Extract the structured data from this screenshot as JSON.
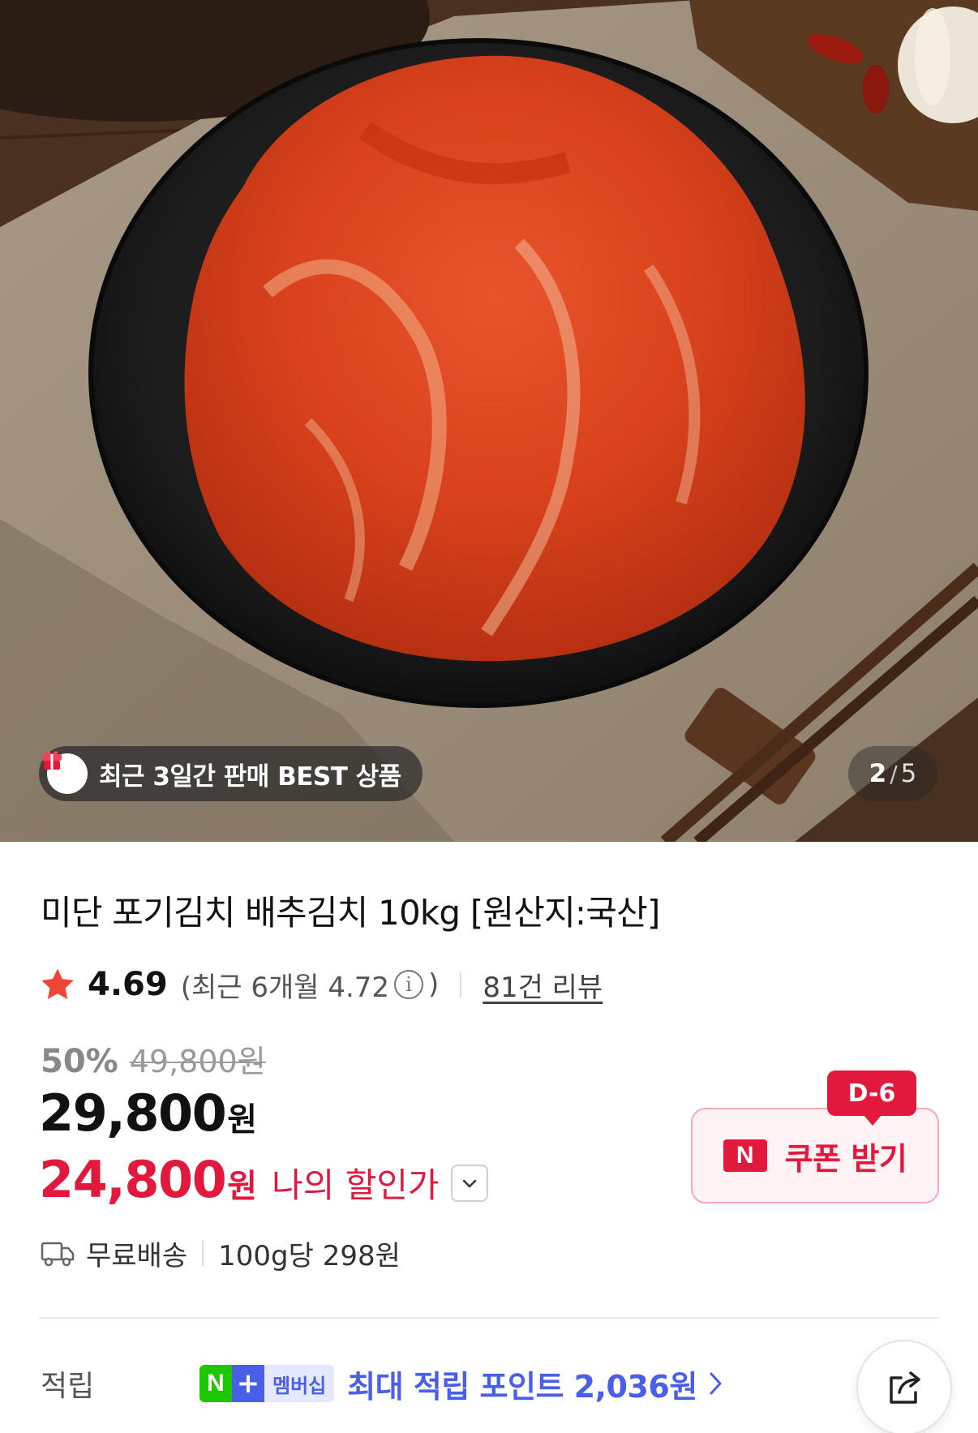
{
  "gallery": {
    "badge_label": "최근 3일간 판매 BEST 상품",
    "current_page": "2",
    "page_separator": "/",
    "total_pages": "5"
  },
  "product": {
    "title": "미단 포기김치 배추김치 10kg [원산지:국산]"
  },
  "rating": {
    "score": "4.69",
    "recent_label": "(최근 6개월 4.72",
    "recent_close": ")",
    "info_glyph": "i",
    "review_link": "81건 리뷰"
  },
  "price": {
    "discount_rate": "50%",
    "original_price": "49,800원",
    "sale_price": "29,800",
    "sale_unit": "원",
    "my_price": "24,800",
    "my_unit": "원",
    "my_price_label": "나의 할인가"
  },
  "coupon": {
    "dday": "D-6",
    "logo": "N",
    "label": "쿠폰 받기"
  },
  "shipping": {
    "label": "무료배송",
    "unit_price": "100g당 298원"
  },
  "points": {
    "label": "적립",
    "n_logo": "N",
    "plus_glyph": "+",
    "membership_label": "멤버십",
    "text": "최대 적립 포인트 2,036원"
  },
  "colors": {
    "accent_red": "#e3183d",
    "membership_blue": "#4a5fe8",
    "naver_green": "#1ec800"
  }
}
